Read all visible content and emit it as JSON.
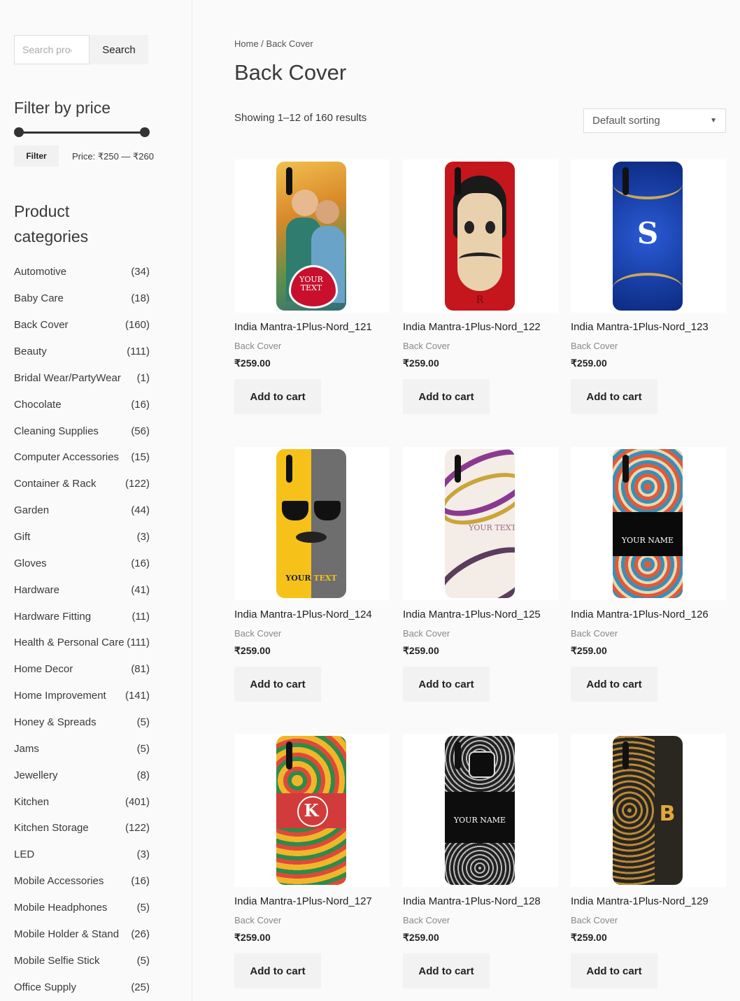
{
  "search": {
    "placeholder": "Search products…",
    "button": "Search"
  },
  "filter": {
    "title": "Filter by price",
    "button": "Filter",
    "price_label": "Price: ₹250 — ₹260"
  },
  "categories": {
    "title_line1": "Product",
    "title_line2": "categories",
    "items": [
      {
        "name": "Automotive",
        "count": "(34)"
      },
      {
        "name": "Baby Care",
        "count": "(18)"
      },
      {
        "name": "Back Cover",
        "count": "(160)"
      },
      {
        "name": "Beauty",
        "count": "(111)"
      },
      {
        "name": "Bridal Wear/PartyWear",
        "count": "(1)"
      },
      {
        "name": "Chocolate",
        "count": "(16)"
      },
      {
        "name": "Cleaning Supplies",
        "count": "(56)"
      },
      {
        "name": "Computer Accessories",
        "count": "(15)"
      },
      {
        "name": "Container & Rack",
        "count": "(122)"
      },
      {
        "name": "Garden",
        "count": "(44)"
      },
      {
        "name": "Gift",
        "count": "(3)"
      },
      {
        "name": "Gloves",
        "count": "(16)"
      },
      {
        "name": "Hardware",
        "count": "(41)"
      },
      {
        "name": "Hardware Fitting",
        "count": "(11)"
      },
      {
        "name": "Health & Personal Care",
        "count": "(111)"
      },
      {
        "name": "Home Decor",
        "count": "(81)"
      },
      {
        "name": "Home Improvement",
        "count": "(141)"
      },
      {
        "name": "Honey & Spreads",
        "count": "(5)"
      },
      {
        "name": "Jams",
        "count": "(5)"
      },
      {
        "name": "Jewellery",
        "count": "(8)"
      },
      {
        "name": "Kitchen",
        "count": "(401)"
      },
      {
        "name": "Kitchen Storage",
        "count": "(122)"
      },
      {
        "name": "LED",
        "count": "(3)"
      },
      {
        "name": "Mobile Accessories",
        "count": "(16)"
      },
      {
        "name": "Mobile Headphones",
        "count": "(5)"
      },
      {
        "name": "Mobile Holder & Stand",
        "count": "(26)"
      },
      {
        "name": "Mobile Selfie Stick",
        "count": "(5)"
      },
      {
        "name": "Office Supply",
        "count": "(25)"
      }
    ]
  },
  "breadcrumb": {
    "home": "Home",
    "separator": " / ",
    "current": "Back Cover"
  },
  "page_title": "Back Cover",
  "result_count": "Showing 1–12 of 160 results",
  "sorting": {
    "selected": "Default sorting"
  },
  "products": [
    {
      "title": "India Mantra-1Plus-Nord_121",
      "category": "Back Cover",
      "price": "₹259.00",
      "cart": "Add to cart",
      "design": {
        "type": "couple",
        "text1": "YOUR",
        "text2": "TEXT"
      }
    },
    {
      "title": "India Mantra-1Plus-Nord_122",
      "category": "Back Cover",
      "price": "₹259.00",
      "cart": "Add to cart",
      "design": {
        "type": "mask",
        "text1": "R",
        "text2": ""
      }
    },
    {
      "title": "India Mantra-1Plus-Nord_123",
      "category": "Back Cover",
      "price": "₹259.00",
      "cart": "Add to cart",
      "design": {
        "type": "blue-s",
        "text1": "S",
        "text2": ""
      }
    },
    {
      "title": "India Mantra-1Plus-Nord_124",
      "category": "Back Cover",
      "price": "₹259.00",
      "cart": "Add to cart",
      "design": {
        "type": "mustache",
        "text1": "YOUR",
        "text2": "TEXT"
      }
    },
    {
      "title": "India Mantra-1Plus-Nord_125",
      "category": "Back Cover",
      "price": "₹259.00",
      "cart": "Add to cart",
      "design": {
        "type": "swirl",
        "text1": "YOUR TEXT",
        "text2": ""
      }
    },
    {
      "title": "India Mantra-1Plus-Nord_126",
      "category": "Back Cover",
      "price": "₹259.00",
      "cart": "Add to cart",
      "design": {
        "type": "paisley",
        "text1": "YOUR NAME",
        "text2": ""
      }
    },
    {
      "title": "India Mantra-1Plus-Nord_127",
      "category": "Back Cover",
      "price": "₹259.00",
      "cart": "Add to cart",
      "design": {
        "type": "floral-k",
        "text1": "K",
        "text2": ""
      }
    },
    {
      "title": "India Mantra-1Plus-Nord_128",
      "category": "Back Cover",
      "price": "₹259.00",
      "cart": "Add to cart",
      "design": {
        "type": "lace",
        "text1": "YOUR NAME",
        "text2": ""
      }
    },
    {
      "title": "India Mantra-1Plus-Nord_129",
      "category": "Back Cover",
      "price": "₹259.00",
      "cart": "Add to cart",
      "design": {
        "type": "gold-b",
        "text1": "B",
        "text2": ""
      }
    }
  ]
}
